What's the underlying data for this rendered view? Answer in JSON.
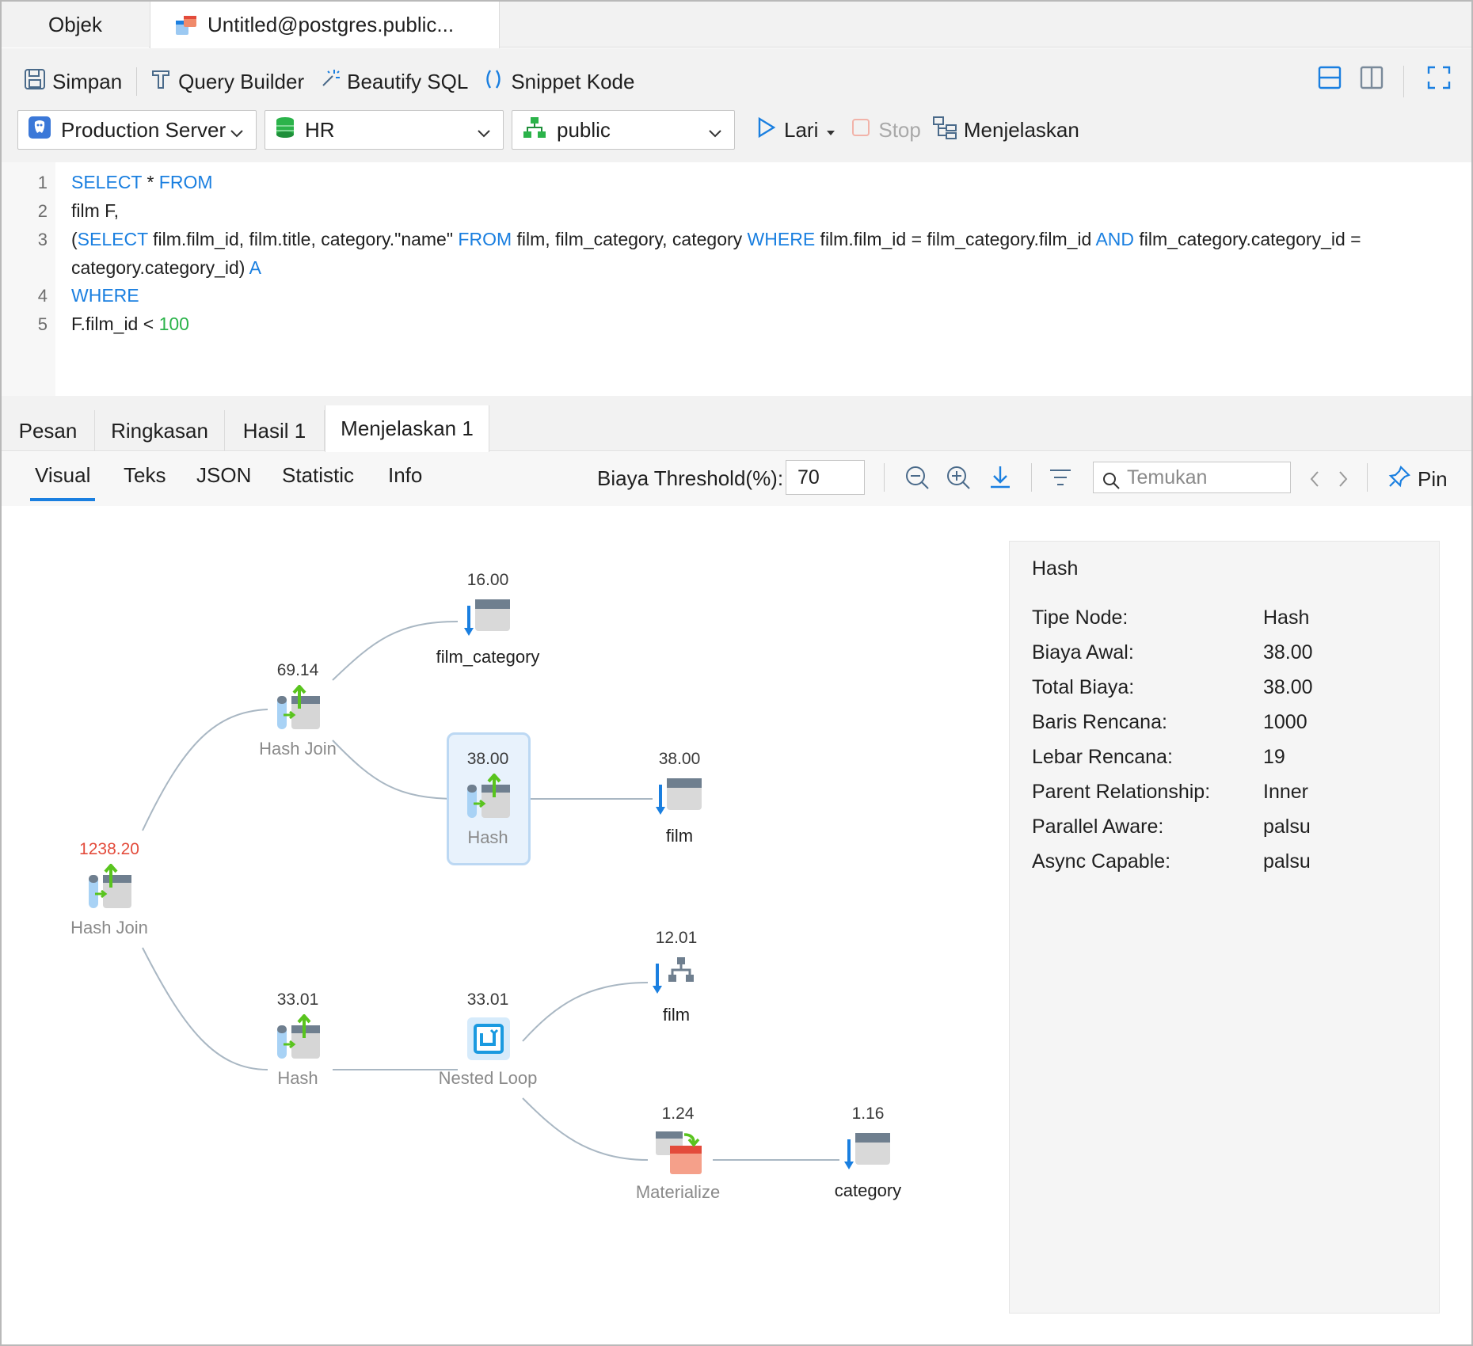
{
  "tabs": {
    "objects": "Objek",
    "query_tab": "Untitled@postgres.public..."
  },
  "toolbar": {
    "save": "Simpan",
    "query_builder": "Query Builder",
    "beautify": "Beautify SQL",
    "snippet": "Snippet Kode",
    "connection": "Production Server",
    "database": "HR",
    "schema": "public",
    "run": "Lari",
    "stop": "Stop",
    "explain": "Menjelaskan"
  },
  "editor": {
    "line_numbers": [
      "1",
      "2",
      "3",
      "",
      "4",
      "5"
    ],
    "lines": {
      "l1_kw1": "SELECT",
      "l1_mid": " * ",
      "l1_kw2": "FROM",
      "l2": "film F,",
      "l3_p1": "(",
      "l3_kw1": "SELECT",
      "l3_p2": " film.film_id, film.title, category.\"name\" ",
      "l3_kw2": "FROM",
      "l3_p3": " film, film_category, category ",
      "l3_kw3": "WHERE",
      "l3_p4": " film.film_id = film_category.film_id ",
      "l3_kw4": "AND",
      "l3_p5": " film_category.category_id =",
      "l3b_p1": "category.category_id) ",
      "l3b_kw": "A",
      "l4_kw": "WHERE",
      "l5_p1": "F.film_id < ",
      "l5_num": "100"
    }
  },
  "result_tabs": [
    "Pesan",
    "Ringkasan",
    "Hasil 1",
    "Menjelaskan 1"
  ],
  "sub_tabs": [
    "Visual",
    "Teks",
    "JSON",
    "Statistic",
    "Info"
  ],
  "threshold": {
    "label": "Biaya Threshold(%):",
    "value": "70"
  },
  "search": {
    "placeholder": "Temukan"
  },
  "pin": "Pin",
  "plan_nodes": {
    "root": {
      "cost": "1238.20",
      "label": "Hash Join"
    },
    "hashjoin2": {
      "cost": "69.14",
      "label": "Hash Join"
    },
    "film_category": {
      "cost": "16.00",
      "label": "film_category"
    },
    "hash1": {
      "cost": "38.00",
      "label": "Hash"
    },
    "film1": {
      "cost": "38.00",
      "label": "film"
    },
    "hash2": {
      "cost": "33.01",
      "label": "Hash"
    },
    "nested": {
      "cost": "33.01",
      "label": "Nested Loop"
    },
    "film2": {
      "cost": "12.01",
      "label": "film"
    },
    "materialize": {
      "cost": "1.24",
      "label": "Materialize"
    },
    "category": {
      "cost": "1.16",
      "label": "category"
    }
  },
  "details": {
    "title": "Hash",
    "rows": [
      {
        "key": "Tipe Node:",
        "value": "Hash"
      },
      {
        "key": "Biaya Awal:",
        "value": "38.00"
      },
      {
        "key": "Total Biaya:",
        "value": "38.00"
      },
      {
        "key": "Baris Rencana:",
        "value": "1000"
      },
      {
        "key": "Lebar Rencana:",
        "value": "19"
      },
      {
        "key": "Parent Relationship:",
        "value": "Inner"
      },
      {
        "key": "Parallel Aware:",
        "value": "palsu"
      },
      {
        "key": "Async Capable:",
        "value": "palsu"
      }
    ]
  },
  "colors": {
    "accent": "#1a7fe0",
    "hot_cost": "#e34b3b",
    "number": "#2bb34a"
  }
}
